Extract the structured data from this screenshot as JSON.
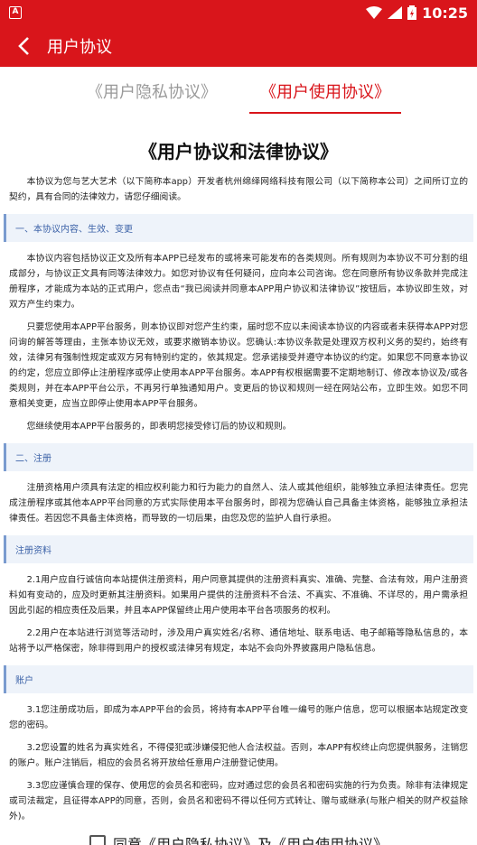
{
  "status": {
    "time": "10:25",
    "notification": "A"
  },
  "appbar": {
    "title": "用户协议"
  },
  "tabs": [
    {
      "label": "《用户隐私协议》",
      "active": false
    },
    {
      "label": "《用户使用协议》",
      "active": true
    }
  ],
  "doc": {
    "title": "《用户协议和法律协议》",
    "intro": "本协议为您与艺大艺术（以下简称本app）开发者杭州绵绎网络科技有限公司（以下简称本公司）之间所订立的契约，具有合同的法律效力，请您仔细阅读。",
    "s1_title": "一、本协议内容、生效、变更",
    "s1_p1": "本协议内容包括协议正文及所有本APP已经发布的或将来可能发布的各类规则。所有规则为本协议不可分割的组成部分，与协议正文具有同等法律效力。如您对协议有任何疑问，应向本公司咨询。您在同意所有协议条款并完成注册程序，才能成为本站的正式用户，您点击“我已阅读并同意本APP用户协议和法律协议”按钮后，本协议即生效，对双方产生约束力。",
    "s1_p2": "只要您使用本APP平台服务，则本协议即对您产生约束，届时您不应以未阅读本协议的内容或者未获得本APP对您问询的解答等理由，主张本协议无效，或要求撤销本协议。您确认:本协议条款是处理双方权利义务的契约，始终有效，法律另有强制性规定或双方另有特别约定的，依其规定。您承诺接受并遵守本协议的约定。如果您不同意本协议的约定，您应立即停止注册程序或停止使用本APP平台服务。本APP有权根据需要不定期地制订、修改本协议及/或各类规则，并在本APP平台公示，不再另行单独通知用户。变更后的协议和规则一经在网站公布，立即生效。如您不同意相关变更，应当立即停止使用本APP平台服务。",
    "s1_p3": "您继续使用本APP平台服务的，即表明您接受修订后的协议和规则。",
    "s2_title": "二、注册",
    "s2_p1": "注册资格用户须具有法定的相应权利能力和行为能力的自然人、法人或其他组织，能够独立承担法律责任。您完成注册程序或其他本APP平台同意的方式实际使用本平台服务时，即视为您确认自己具备主体资格，能够独立承担法律责任。若因您不具备主体资格，而导致的一切后果，由您及您的监护人自行承担。",
    "s3_title": "注册资料",
    "s3_p1": "2.1用户应自行诚信向本站提供注册资料，用户同意其提供的注册资料真实、准确、完整、合法有效，用户注册资料如有变动的，应及时更新其注册资料。如果用户提供的注册资料不合法、不真实、不准确、不详尽的，用户需承担因此引起的相应责任及后果，并且本APP保留终止用户使用本平台各项服务的权利。",
    "s3_p2": "2.2用户在本站进行浏览等活动时，涉及用户真实姓名/名称、通信地址、联系电话、电子邮箱等隐私信息的，本站将予以严格保密，除非得到用户的授权或法律另有规定，本站不会向外界披露用户隐私信息。",
    "s4_title": "账户",
    "s4_p1": "3.1您注册成功后，即成为本APP平台的会员，将持有本APP平台唯一编号的账户信息，您可以根据本站规定改变您的密码。",
    "s4_p2": "3.2您设置的姓名为真实姓名，不得侵犯或涉嫌侵犯他人合法权益。否则，本APP有权终止向您提供服务，注销您的账户。账户注销后，相应的会员名将开放给任意用户注册登记使用。",
    "s4_p3": "3.3您应谨慎合理的保存、使用您的会员名和密码，应对通过您的会员名和密码实施的行为负责。除非有法律规定或司法裁定，且征得本APP的同意，否则，会员名和密码不得以任何方式转让、赠与或继承(与账户相关的财产权益除外)。"
  },
  "agree": {
    "label": "同意《用户隐私协议》及《用户使用协议》"
  }
}
